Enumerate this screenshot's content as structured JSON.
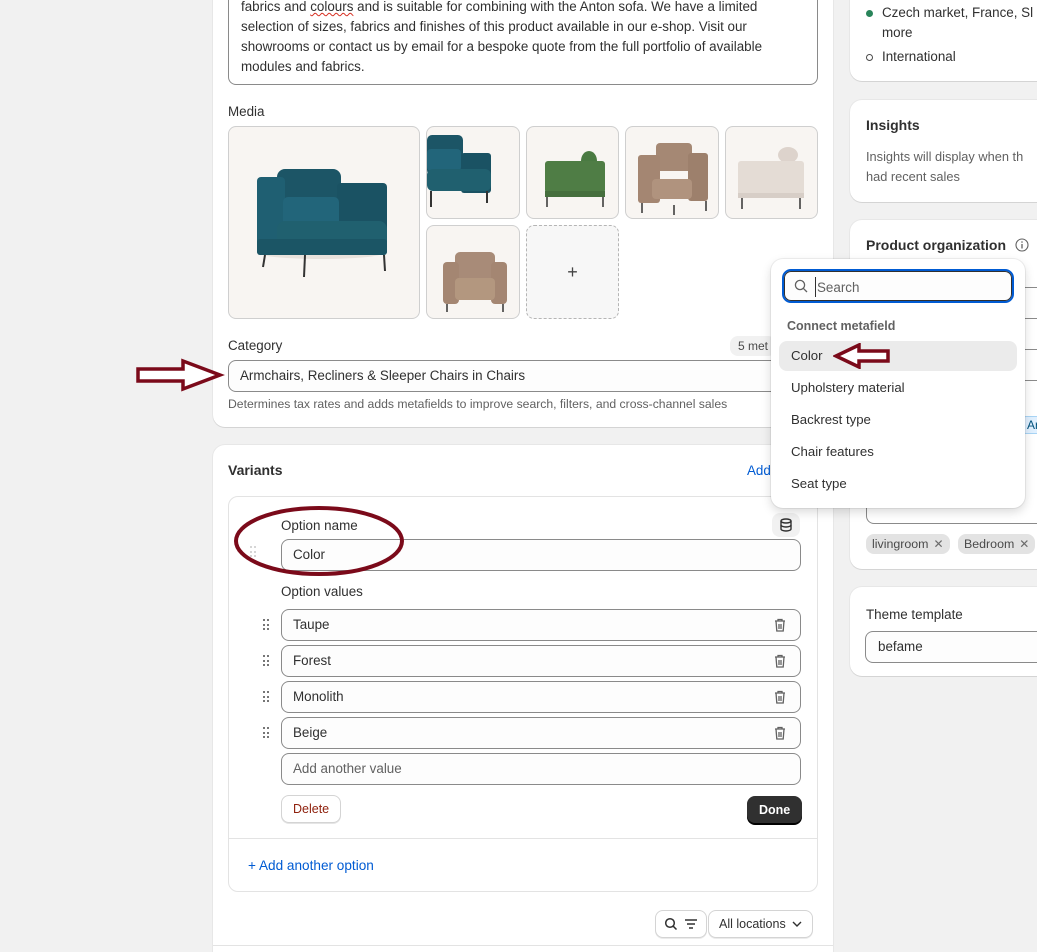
{
  "product": {
    "description_lines": [
      {
        "before": "fabrics and ",
        "misspelled": "colours",
        "after": " and is suitable for combining with the Anton sofa. We have a limited"
      },
      {
        "text": "selection of sizes, fabrics and finishes of this product available in our e-shop. Visit our"
      },
      {
        "text": "showrooms or contact us by email for a bespoke quote from the full portfolio of available"
      },
      {
        "text": "modules and fabrics."
      }
    ],
    "media_label": "Media",
    "media_items": [
      {
        "alt": "Teal armchair front view",
        "color": "#1f5a6b"
      },
      {
        "alt": "Teal armchair close-up",
        "color": "#1f5a6b"
      },
      {
        "alt": "Green armchair side view",
        "color": "#4f7d45"
      },
      {
        "alt": "Taupe armchair",
        "color": "#a78a76"
      },
      {
        "alt": "Beige armchair side view",
        "color": "#e2dad3"
      },
      {
        "alt": "Taupe leather armchair",
        "color": "#a78a76"
      }
    ],
    "media_add_icon": "+",
    "category_label": "Category",
    "category_badge": "5 met",
    "category_value": "Armchairs, Recliners & Sleeper Chairs in Chairs",
    "category_help": "Determines tax rates and adds metafields to improve search, filters, and cross-channel sales"
  },
  "variants": {
    "title": "Variants",
    "add_link": "Add",
    "option_name_label": "Option name",
    "option_name_value": "Color",
    "option_values_label": "Option values",
    "option_values": [
      "Taupe",
      "Forest",
      "Monolith",
      "Beige"
    ],
    "add_value_placeholder": "Add another value",
    "delete_label": "Delete",
    "done_label": "Done",
    "add_option_label": "+ Add another option",
    "locations_label": "All locations"
  },
  "sidebar": {
    "markets": [
      {
        "label": "Czech market, France, Sl",
        "status": "active",
        "color": "#29845a"
      },
      {
        "label": "more",
        "status": "continuation"
      },
      {
        "label": "International",
        "status": "inactive"
      }
    ],
    "insights_title": "Insights",
    "insights_text_lines": [
      "Insights will display when th",
      "had recent sales"
    ],
    "org_title": "Product organization",
    "type_badge": "Ar",
    "tags": [
      "livingroom",
      "Bedroom"
    ],
    "theme_label": "Theme template",
    "theme_value": "befame"
  },
  "popover": {
    "search_placeholder": "Search",
    "section_title": "Connect metafield",
    "items": [
      "Color",
      "Upholstery material",
      "Backrest type",
      "Chair features",
      "Seat type"
    ],
    "active_index": 0
  },
  "annotations": {
    "color": "#7b0a1a"
  }
}
